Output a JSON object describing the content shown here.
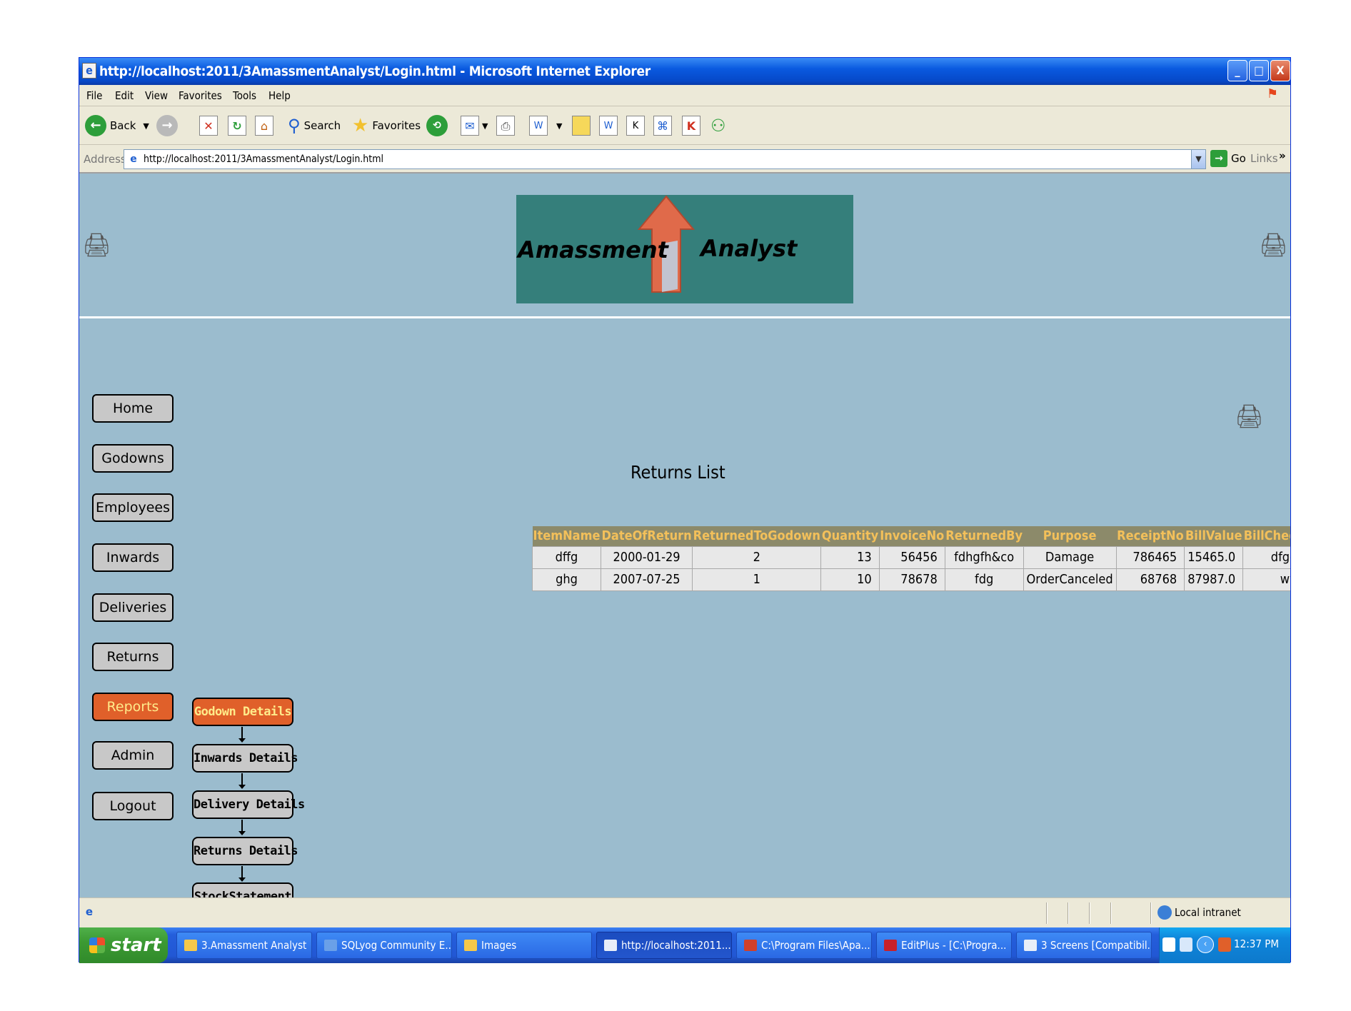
{
  "window": {
    "title": "http://localhost:2011/3AmassmentAnalyst/Login.html - Microsoft Internet Explorer",
    "min_label": "_",
    "max_label": "□",
    "close_label": "X"
  },
  "menu": [
    "File",
    "Edit",
    "View",
    "Favorites",
    "Tools",
    "Help"
  ],
  "toolbar": {
    "back_label": "Back",
    "search_label": "Search",
    "favorites_label": "Favorites"
  },
  "address": {
    "label": "Address",
    "url": "http://localhost:2011/3AmassmentAnalyst/Login.html",
    "go_label": "Go",
    "links_label": "Links"
  },
  "banner": {
    "word1": "Amassment",
    "word2": "Analyst"
  },
  "nav": {
    "items": [
      "Home",
      "Godowns",
      "Employees",
      "Inwards",
      "Deliveries",
      "Returns",
      "Reports",
      "Admin",
      "Logout"
    ],
    "active": "Reports"
  },
  "reports_menu": {
    "items": [
      "Godown Details",
      "Inwards Details",
      "Delivery Details",
      "Returns Details",
      "StockStatement"
    ],
    "active": "Godown Details"
  },
  "returns": {
    "title": "Returns List",
    "columns": [
      "ItemName",
      "DateOfReturn",
      "ReturnedToGodown",
      "Quantity",
      "InvoiceNo",
      "ReturnedBy",
      "Purpose",
      "ReceiptNo",
      "BillValue",
      "BillCheckedBy"
    ],
    "rows": [
      [
        "dffg",
        "2000-01-29",
        "2",
        "13",
        "56456",
        "fdhgfh&co",
        "Damage",
        "786465",
        "15465.0",
        "dfgdfg"
      ],
      [
        "ghg",
        "2007-07-25",
        "1",
        "10",
        "78678",
        "fdg",
        "OrderCanceled",
        "68768",
        "87987.0",
        "ww"
      ]
    ]
  },
  "status": {
    "zone": "Local intranet"
  },
  "taskbar": {
    "start_label": "start",
    "tasks": [
      {
        "label": "3.Amassment Analyst",
        "active": false
      },
      {
        "label": "SQLyog Community E...",
        "active": false
      },
      {
        "label": "Images",
        "active": false
      },
      {
        "label": "http://localhost:2011...",
        "active": true
      },
      {
        "label": "C:\\Program Files\\Apa...",
        "active": false
      },
      {
        "label": "EditPlus - [C:\\Progra...",
        "active": false
      },
      {
        "label": "3 Screens [Compatibil...",
        "active": false
      }
    ],
    "clock": "12:37 PM"
  },
  "colors": {
    "page_bg": "#9bbcce",
    "banner_bg": "#357f7b",
    "active_button": "#e0602a",
    "table_header_bg": "#8c8a6a",
    "table_header_text": "#f3c05a"
  },
  "icons": [
    "ie-page-icon",
    "back-icon",
    "forward-icon",
    "stop-icon",
    "refresh-icon",
    "home-icon",
    "search-icon",
    "favorites-star-icon",
    "history-icon",
    "mail-icon",
    "print-icon",
    "edit-icon",
    "printer-icon",
    "globe-icon",
    "windows-flag-icon"
  ]
}
